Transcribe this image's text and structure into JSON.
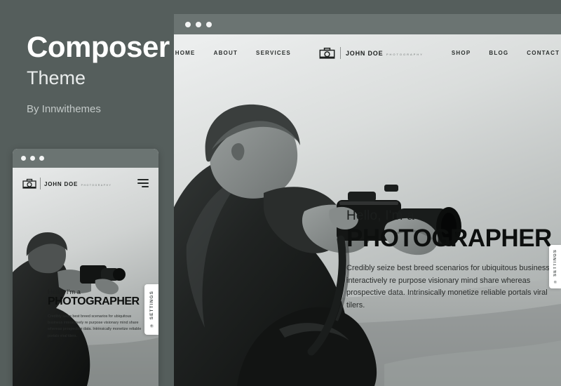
{
  "page": {
    "background_color": "#555e5c"
  },
  "intro": {
    "title": "Composer",
    "subtitle": "Theme",
    "author": "By Innwithemes"
  },
  "window": {
    "titlebar_color": "#6b7472",
    "dots": [
      "dot-1",
      "dot-2",
      "dot-3"
    ]
  },
  "site": {
    "nav_left": [
      {
        "label": "HOME"
      },
      {
        "label": "ABOUT"
      },
      {
        "label": "SERVICES"
      }
    ],
    "nav_right": [
      {
        "label": "SHOP"
      },
      {
        "label": "BLOG"
      },
      {
        "label": "CONTACT"
      }
    ],
    "logo": {
      "icon": "camera-icon",
      "name": "JOHN DOE",
      "tagline": "PHOTOGRAPHY"
    },
    "menu_icon": "hamburger-icon",
    "hero": {
      "greeting": "Hello, I'm a",
      "title": "PHOTOGRAPHER",
      "body": "Credibly seize best breed scenarios for ubiquitous business interactively re purpose visionary mind share whereas prospective data. Intrinsically monetize reliable portals viral tilers."
    }
  },
  "settings_tab": {
    "label": "SETTINGS",
    "icon": "gear-icon"
  }
}
